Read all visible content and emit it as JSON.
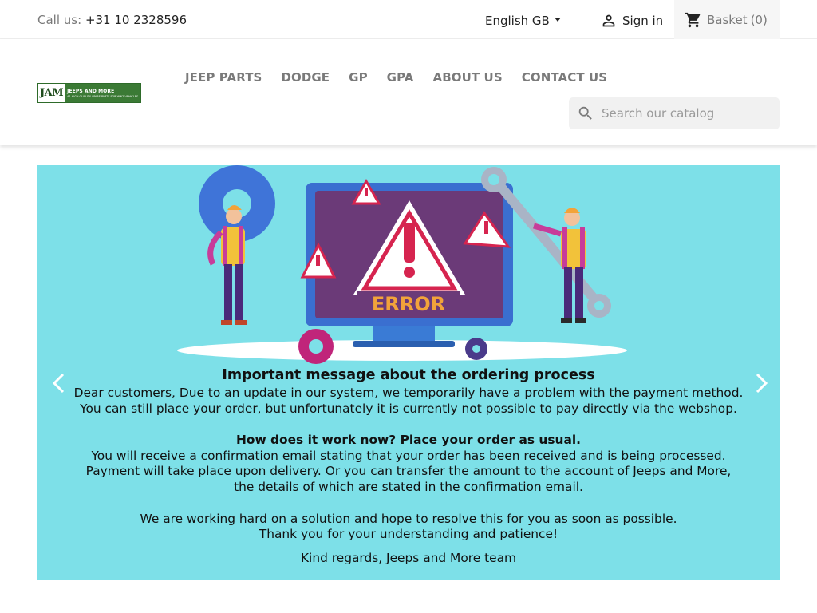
{
  "topbar": {
    "call_label": "Call us:",
    "phone": "+31 10 2328596",
    "language": "English GB",
    "signin": "Sign in",
    "basket_label": "Basket",
    "basket_count": "(0)"
  },
  "logo": {
    "mark": "JAM",
    "name": "JEEPS AND MORE",
    "tagline": "A1 HIGH QUALITY SPARE PARTS FOR WW2 VEHICLES"
  },
  "nav": {
    "items": [
      "JEEP PARTS",
      "DODGE",
      "GP",
      "GPA",
      "ABOUT US",
      "CONTACT US"
    ]
  },
  "search": {
    "placeholder": "Search our catalog"
  },
  "slide": {
    "illustration_text": "ERROR",
    "title": "Important message about the ordering process",
    "line1": "Dear customers, Due to an update in our system, we temporarily have a problem with the payment method.",
    "line2": "You can still place your order, but unfortunately it is currently not possible to pay directly via the webshop.",
    "subtitle": "How does it work now? Place your order as usual.",
    "line3": "You will receive a confirmation email stating that your order has been received and is being processed.",
    "line4": "Payment will take place upon delivery. Or you can transfer the amount to the account of Jeeps and More,",
    "line5": "the details of which are stated in the confirmation email.",
    "line6": "We are working hard on a solution and hope to resolve this for you as soon as possible.",
    "line7": "Thank you for your understanding and patience!",
    "signoff": "Kind regards, Jeeps and More team"
  },
  "colors": {
    "slide_background": "#7de0e8",
    "basket_background": "#f6f6f6",
    "nav_text": "#7a7a7a"
  },
  "icons": [
    "person-icon",
    "shopping-cart-icon",
    "search-icon",
    "chevron-left-icon",
    "chevron-right-icon",
    "caret-down-icon"
  ]
}
